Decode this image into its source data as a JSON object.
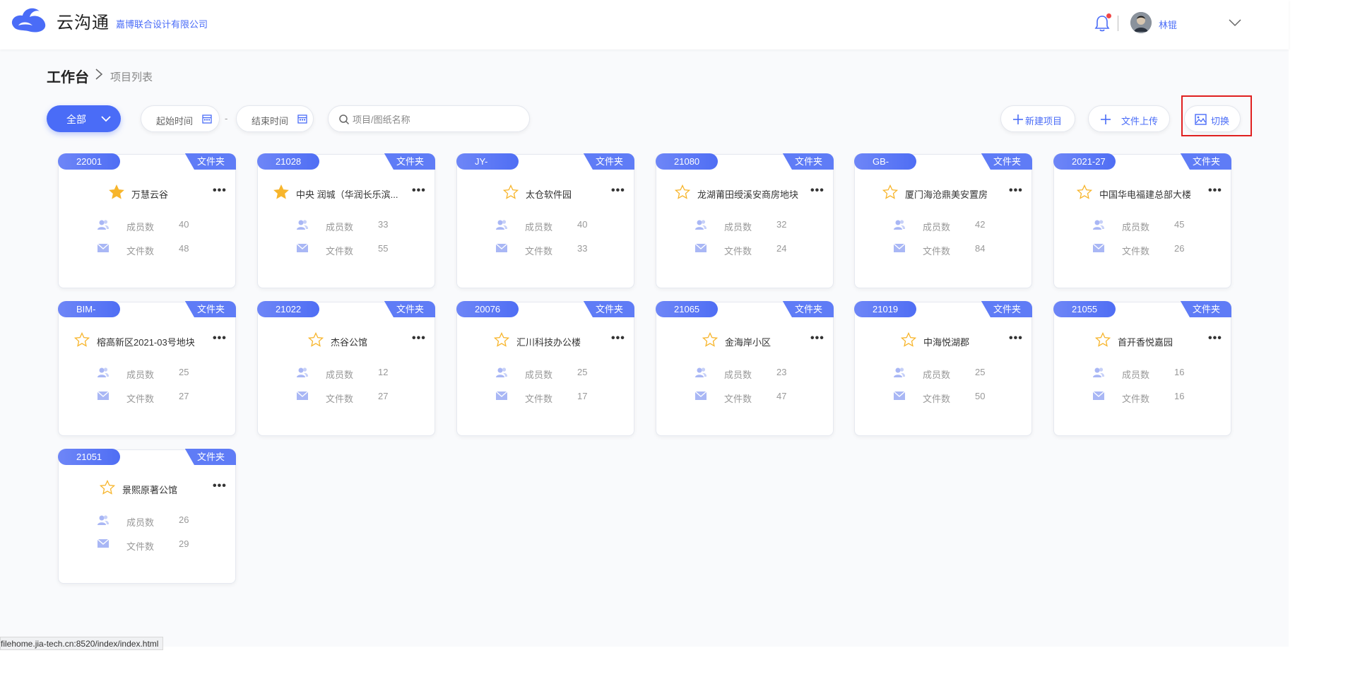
{
  "header": {
    "app_name": "云沟通",
    "company": "嘉博联合设计有限公司",
    "user_name": "林锟",
    "logo_icon": "cloud-swirl-logo",
    "notification_icon": "bell-icon"
  },
  "breadcrumb": {
    "main": "工作台",
    "sub": "项目列表"
  },
  "toolbar": {
    "filter_label": "全部",
    "start_date_label": "起始时间",
    "end_date_label": "结束时间",
    "range_separator": "-",
    "search_placeholder": "项目/图纸名称",
    "new_project_label": "新建项目",
    "upload_label": "文件上传",
    "switch_label": "切换"
  },
  "stat_labels": {
    "members": "成员数",
    "files": "文件数"
  },
  "folder_label": "文件夹",
  "colors": {
    "accent": "#4a6cf7",
    "star_filled": "#f7b52c",
    "highlight_box": "#e02020"
  },
  "projects": [
    {
      "id": "22001",
      "name": "万慧云谷",
      "starred": true,
      "members": "40",
      "files": "48"
    },
    {
      "id": "21028",
      "name": "中央 润城（华润长乐滨...",
      "starred": true,
      "members": "33",
      "files": "55"
    },
    {
      "id": "JY-",
      "name": "太仓软件园",
      "starred": false,
      "members": "40",
      "files": "33"
    },
    {
      "id": "21080",
      "name": "龙湖莆田绶溪安商房地块",
      "starred": false,
      "members": "32",
      "files": "24"
    },
    {
      "id": "GB-",
      "name": "厦门海沧鼎美安置房",
      "starred": false,
      "members": "42",
      "files": "84"
    },
    {
      "id": "2021-27",
      "name": "中国华电福建总部大楼",
      "starred": false,
      "members": "45",
      "files": "26"
    },
    {
      "id": "BIM-",
      "name": "榕高新区2021-03号地块",
      "starred": false,
      "members": "25",
      "files": "27"
    },
    {
      "id": "21022",
      "name": "杰谷公馆",
      "starred": false,
      "members": "12",
      "files": "27"
    },
    {
      "id": "20076",
      "name": "汇川科技办公楼",
      "starred": false,
      "members": "25",
      "files": "17"
    },
    {
      "id": "21065",
      "name": "金海岸小区",
      "starred": false,
      "members": "23",
      "files": "47"
    },
    {
      "id": "21019",
      "name": "中海悦湖郡",
      "starred": false,
      "members": "25",
      "files": "50"
    },
    {
      "id": "21055",
      "name": "首开香悦嘉园",
      "starred": false,
      "members": "16",
      "files": "16"
    },
    {
      "id": "21051",
      "name": "景熙原著公馆",
      "starred": false,
      "members": "26",
      "files": "29"
    }
  ],
  "status_url": "filehome.jia-tech.cn:8520/index/index.html"
}
